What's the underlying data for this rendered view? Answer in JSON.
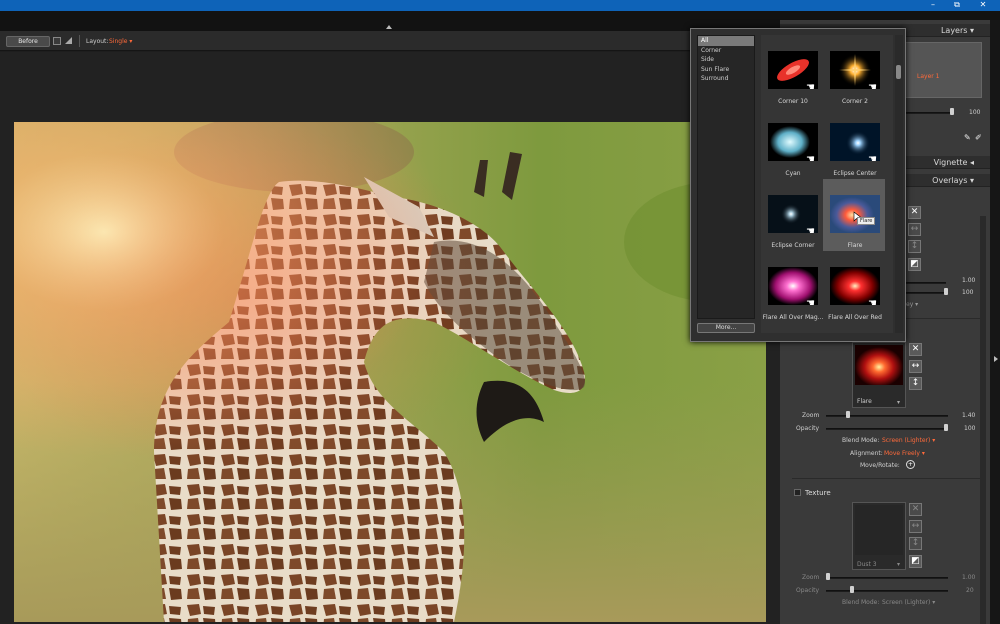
{
  "window": {
    "min_glyph": "–",
    "restore_glyph": "⧉",
    "close_glyph": "✕"
  },
  "toolbar": {
    "before_label": "Before",
    "layout_label": "Layout:",
    "layout_value": "Single"
  },
  "layers_panel": {
    "title": "Layers",
    "layer_name": "Layer 1",
    "opacity_value": "100"
  },
  "vignette_panel": {
    "title": "Vignette"
  },
  "overlays_panel": {
    "title": "Overlays",
    "value_1": "1.00",
    "value_2": "100",
    "blend_partial": "ey"
  },
  "flare_section": {
    "thumb_label": "Flare",
    "zoom_label": "Zoom",
    "zoom_value": "1.40",
    "zoom_fraction": 0.17,
    "opacity_label": "Opacity",
    "opacity_value": "100",
    "opacity_fraction": 1.0,
    "blend_label": "Blend Mode:",
    "blend_value": "Screen (Lighter)",
    "align_label": "Alignment:",
    "align_value": "Move Freely",
    "move_label": "Move/Rotate:"
  },
  "texture_section": {
    "title": "Texture",
    "thumb_label": "Dust 3",
    "zoom_label": "Zoom",
    "zoom_value": "1.00",
    "zoom_fraction": 0.0,
    "opacity_label": "Opacity",
    "opacity_value": "20",
    "opacity_fraction": 0.2,
    "blend_label": "Blend Mode:",
    "blend_value": "Screen (Lighter)"
  },
  "popup": {
    "categories": [
      "All",
      "Corner",
      "Side",
      "Sun Flare",
      "Surround"
    ],
    "selected_category": "All",
    "more_label": "More...",
    "thumbnails": [
      {
        "label": "Corner 10",
        "color": "#e8322a"
      },
      {
        "label": "Corner 2",
        "color": "#ff9a20"
      },
      {
        "label": "Cyan",
        "color": "#9fe0f0"
      },
      {
        "label": "Eclipse Center",
        "color": "#cfefff"
      },
      {
        "label": "Eclipse Corner",
        "color": "#ffffff"
      },
      {
        "label": "Flare",
        "color": "#ff5a3a"
      },
      {
        "label": "Flare All Over Mag...",
        "color": "#ff3fb0"
      },
      {
        "label": "Flare All Over Red",
        "color": "#ff2020"
      }
    ],
    "selected_thumbnail": "Flare",
    "tooltip": "Flare"
  }
}
